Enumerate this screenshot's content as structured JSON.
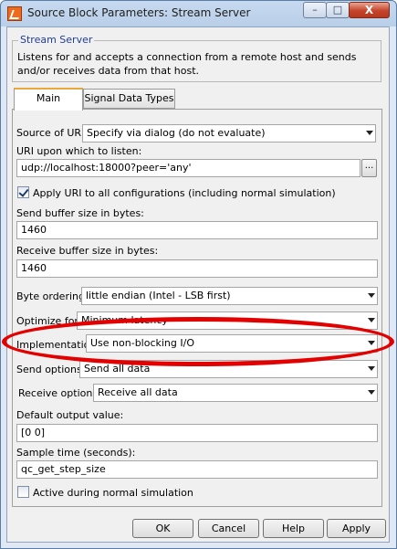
{
  "window": {
    "title": "Source Block Parameters: Stream Server",
    "controls": {
      "minimize": "–",
      "maximize": "□",
      "close": "X"
    },
    "icon": "simulink-block-icon"
  },
  "description": {
    "heading": "Stream Server",
    "text": "Listens for and accepts a connection from a remote host and sends and/or receives data from that host."
  },
  "tabs": [
    {
      "label": "Main",
      "active": true
    },
    {
      "label": "Signal Data Types",
      "active": false
    }
  ],
  "form": {
    "source_of_uri": {
      "label": "Source of URI:",
      "value": "Specify via dialog (do not evaluate)"
    },
    "uri": {
      "label": "URI upon which to listen:",
      "value": "udp://localhost:18000?peer='any'",
      "browse": "..."
    },
    "apply_uri": {
      "label": "Apply URI to all configurations (including normal simulation)",
      "checked": true
    },
    "send_buffer": {
      "label": "Send buffer size in bytes:",
      "value": "1460"
    },
    "receive_buffer": {
      "label": "Receive buffer size in bytes:",
      "value": "1460"
    },
    "byte_ordering": {
      "label": "Byte ordering:",
      "value": "little endian (Intel - LSB first)"
    },
    "optimize_for": {
      "label": "Optimize for:",
      "value": "Minimum latency"
    },
    "implementation": {
      "label": "Implementation:",
      "value": "Use non-blocking I/O"
    },
    "send_options": {
      "label": "Send options:",
      "value": "Send all data"
    },
    "receive_options": {
      "label": "Receive options:",
      "value": "Receive all data"
    },
    "default_output": {
      "label": "Default output value:",
      "value": "[0 0]"
    },
    "sample_time": {
      "label": "Sample time (seconds):",
      "value": "qc_get_step_size"
    },
    "active_normal": {
      "label": "Active during normal simulation",
      "checked": false
    }
  },
  "buttons": {
    "ok": "OK",
    "cancel": "Cancel",
    "help": "Help",
    "apply": "Apply"
  },
  "colors": {
    "annotation": "#e30000",
    "group_title": "#1f3d99"
  }
}
